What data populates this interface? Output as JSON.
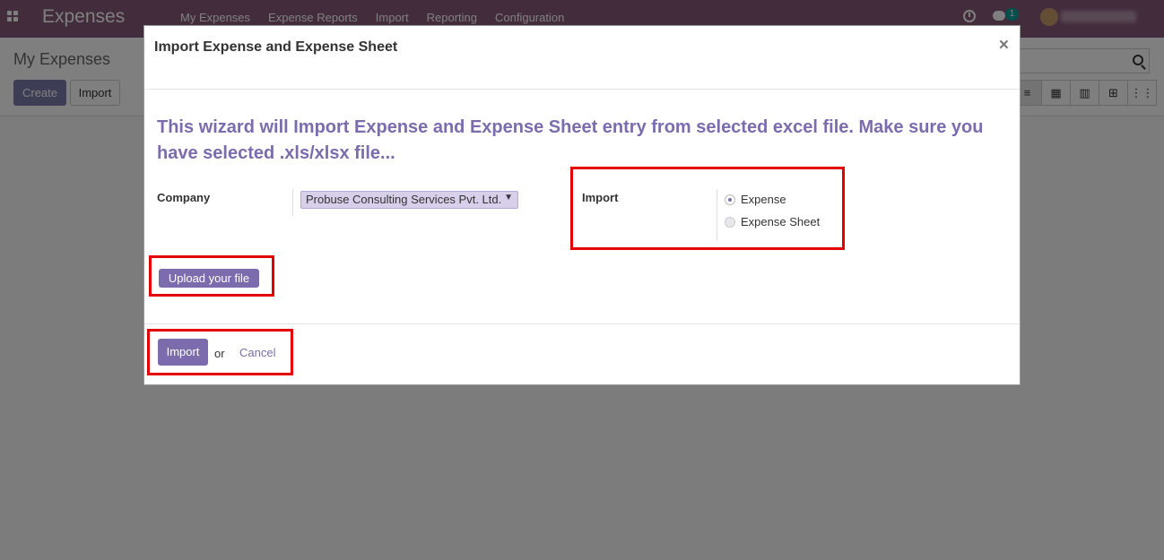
{
  "navbar": {
    "app_title": "Expenses",
    "menu": [
      "My Expenses",
      "Expense Reports",
      "Import",
      "Reporting",
      "Configuration"
    ],
    "chat_badge": "1"
  },
  "control_panel": {
    "breadcrumb": "My Expenses",
    "create_label": "Create",
    "import_label": "Import"
  },
  "modal": {
    "title": "Import Expense and Expense Sheet",
    "close_glyph": "×",
    "wizard_text": "This wizard will Import Expense and Expense Sheet entry from selected excel file. Make sure you have selected .xls/xlsx file...",
    "company_label": "Company",
    "company_value": "Probuse Consulting Services Pvt. Ltd.",
    "import_label": "Import",
    "import_options": [
      {
        "label": "Expense",
        "selected": true
      },
      {
        "label": "Expense Sheet",
        "selected": false
      }
    ],
    "upload_label": "Upload your file",
    "footer": {
      "import_button": "Import",
      "or_text": "or",
      "cancel_link": "Cancel"
    }
  },
  "colors": {
    "brand": "#875a7b",
    "accent": "#7c6cad",
    "highlight": "#e30000"
  }
}
